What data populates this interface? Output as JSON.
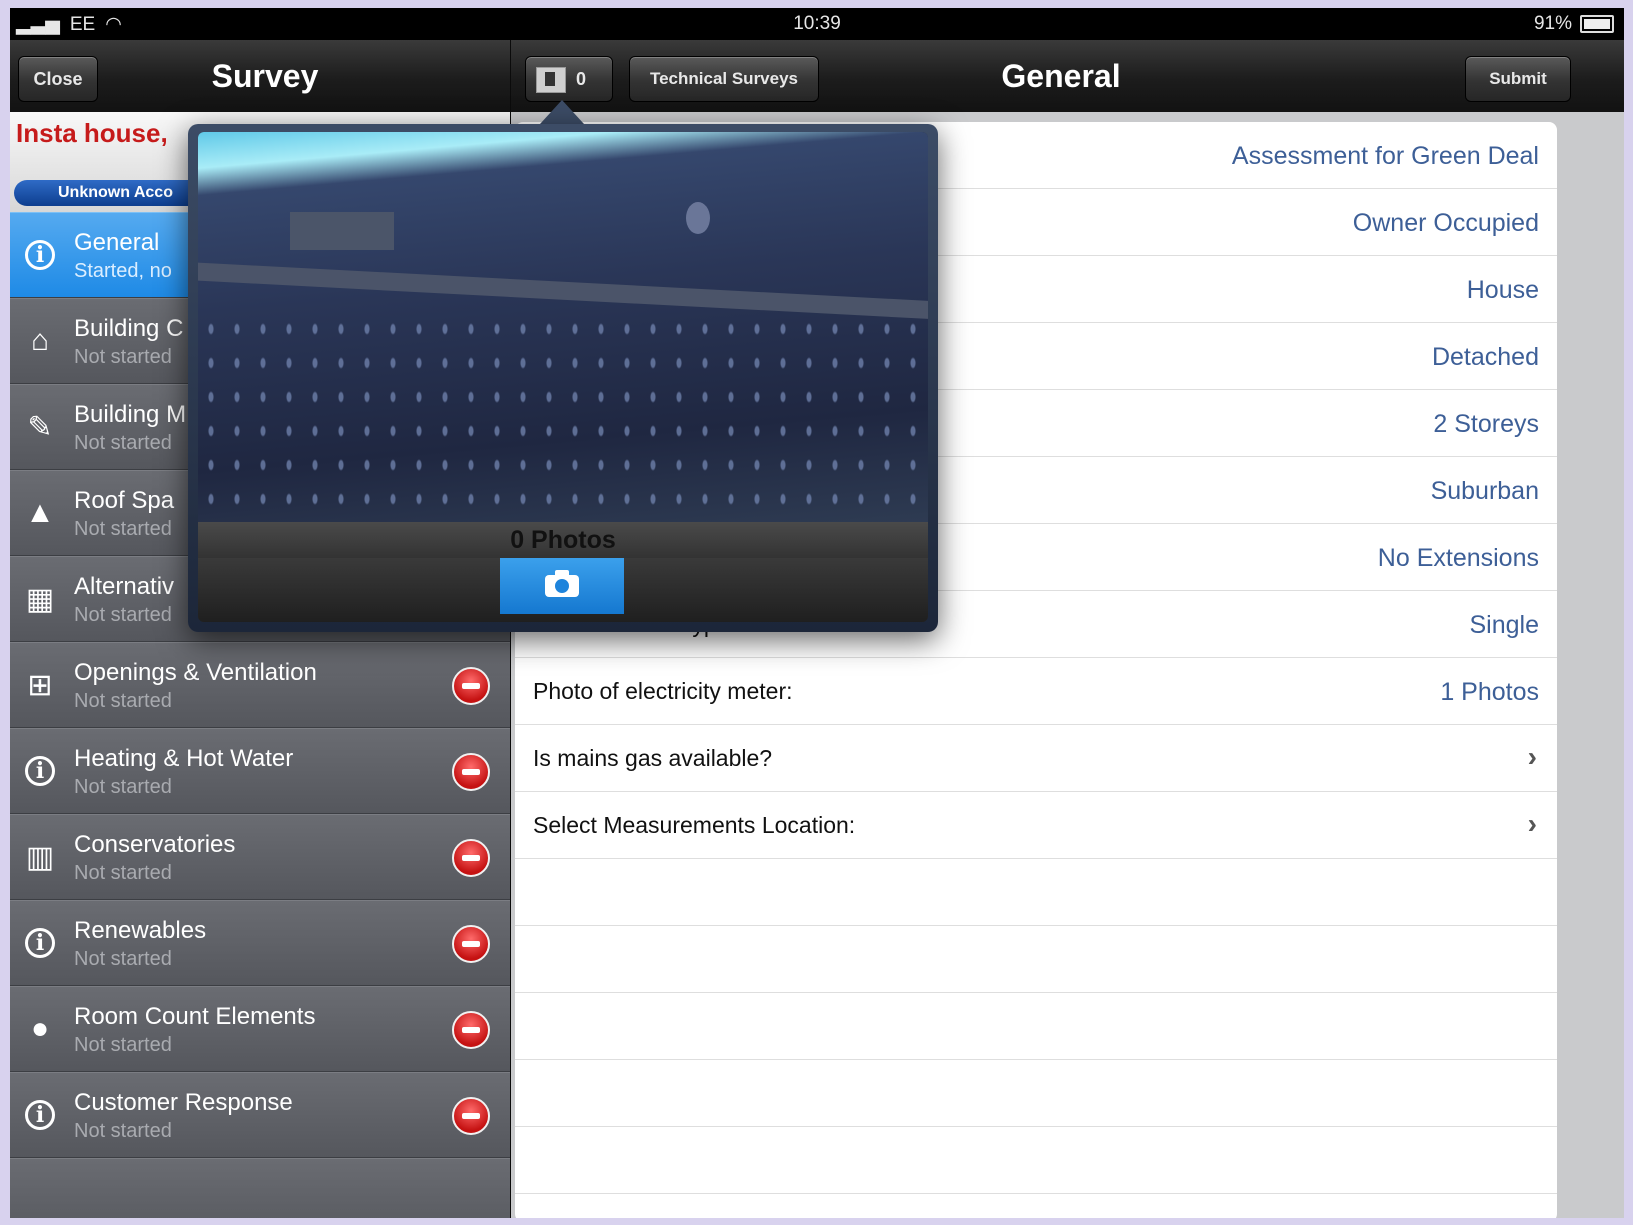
{
  "status_bar": {
    "carrier": "EE",
    "time": "10:39",
    "battery": "91%"
  },
  "left_nav": {
    "close_label": "Close",
    "title": "Survey"
  },
  "right_nav": {
    "photo_count": "0",
    "technical_surveys_label": "Technical Surveys",
    "title": "General",
    "submit_label": "Submit"
  },
  "sidebar": {
    "property_name": "Insta house,",
    "account_status": "Unknown Acco",
    "items": [
      {
        "title": "General",
        "status": "Started, no",
        "icon": "info-icon",
        "active": true
      },
      {
        "title": "Building C",
        "status": "Not started",
        "icon": "house-icon"
      },
      {
        "title": "Building M",
        "status": "Not started",
        "icon": "ruler-icon"
      },
      {
        "title": "Roof Spa",
        "status": "Not started",
        "icon": "roof-icon"
      },
      {
        "title": "Alternativ",
        "status": "Not started",
        "icon": "bricks-icon"
      },
      {
        "title": "Openings & Ventilation",
        "status": "Not started",
        "icon": "window-icon"
      },
      {
        "title": "Heating & Hot Water",
        "status": "Not started",
        "icon": "info-icon"
      },
      {
        "title": "Conservatories",
        "status": "Not started",
        "icon": "conservatory-icon"
      },
      {
        "title": "Renewables",
        "status": "Not started",
        "icon": "info-icon"
      },
      {
        "title": "Room Count Elements",
        "status": "Not started",
        "icon": "bulb-icon"
      },
      {
        "title": "Customer Response",
        "status": "Not started",
        "icon": "info-icon"
      }
    ]
  },
  "form": {
    "rows": [
      {
        "label": "",
        "value": "Assessment for Green Deal"
      },
      {
        "label": "",
        "value": "Owner Occupied"
      },
      {
        "label": "",
        "value": "House"
      },
      {
        "label": "",
        "value": "Detached"
      },
      {
        "label": "",
        "value": "2 Storeys"
      },
      {
        "label": "",
        "value": "Suburban"
      },
      {
        "label": "",
        "value": "No Extensions"
      },
      {
        "label": "Electric Meter Type:",
        "value": "Single"
      },
      {
        "label": "Photo of electricity meter:",
        "value": "1 Photos"
      },
      {
        "label": "Is mains gas available?",
        "value": ""
      },
      {
        "label": "Select Measurements Location:",
        "value": ""
      }
    ]
  },
  "popover": {
    "photo_count_label": "0 Photos"
  },
  "colors": {
    "accent": "#1e8ae6",
    "value_text": "#3d5f97",
    "delete_red": "#c51212",
    "property_red": "#c61b1b"
  }
}
